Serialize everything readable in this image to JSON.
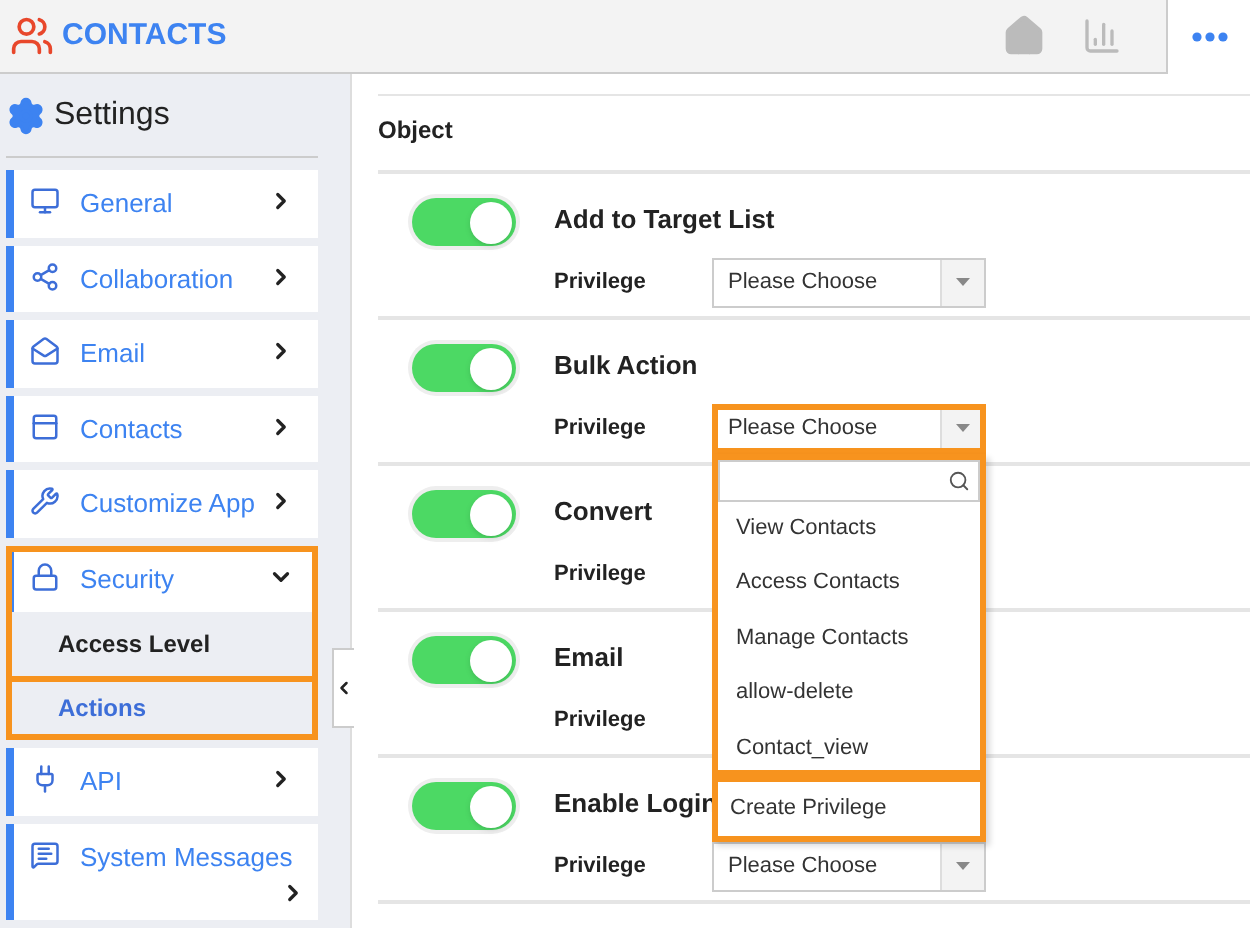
{
  "header": {
    "app_title": "CONTACTS"
  },
  "sidebar": {
    "title": "Settings",
    "items": [
      {
        "label": "General",
        "expanded": false,
        "highlighted": false
      },
      {
        "label": "Collaboration",
        "expanded": false,
        "highlighted": false
      },
      {
        "label": "Email",
        "expanded": false,
        "highlighted": false
      },
      {
        "label": "Contacts",
        "expanded": false,
        "highlighted": false
      },
      {
        "label": "Customize App",
        "expanded": false,
        "highlighted": false
      },
      {
        "label": "Security",
        "expanded": true,
        "highlighted": true,
        "children": [
          {
            "label": "Access Level",
            "selected": false,
            "highlighted": false
          },
          {
            "label": "Actions",
            "selected": true,
            "highlighted": true
          }
        ]
      },
      {
        "label": "API",
        "expanded": false,
        "highlighted": false
      },
      {
        "label": "System Messages",
        "expanded": false,
        "highlighted": false
      }
    ]
  },
  "main": {
    "section_title": "Object",
    "rows": [
      {
        "name": "Add to Target List",
        "on": true,
        "privilege_label": "Privilege",
        "select_value": "Please Choose"
      },
      {
        "name": "Bulk Action",
        "on": true,
        "privilege_label": "Privilege",
        "select_value": "Please Choose",
        "highlighted": true,
        "dropdown": {
          "options": [
            "View Contacts",
            "Access Contacts",
            "Manage Contacts",
            "allow-delete",
            "Contact_view"
          ],
          "footer": "Create Privilege",
          "footer_highlighted": true
        }
      },
      {
        "name": "Convert",
        "on": true,
        "privilege_label": "Privilege"
      },
      {
        "name": "Email",
        "on": true,
        "privilege_label": "Privilege"
      },
      {
        "name": "Enable Login",
        "on": true,
        "privilege_label": "Privilege",
        "select_value": "Please Choose"
      }
    ]
  }
}
